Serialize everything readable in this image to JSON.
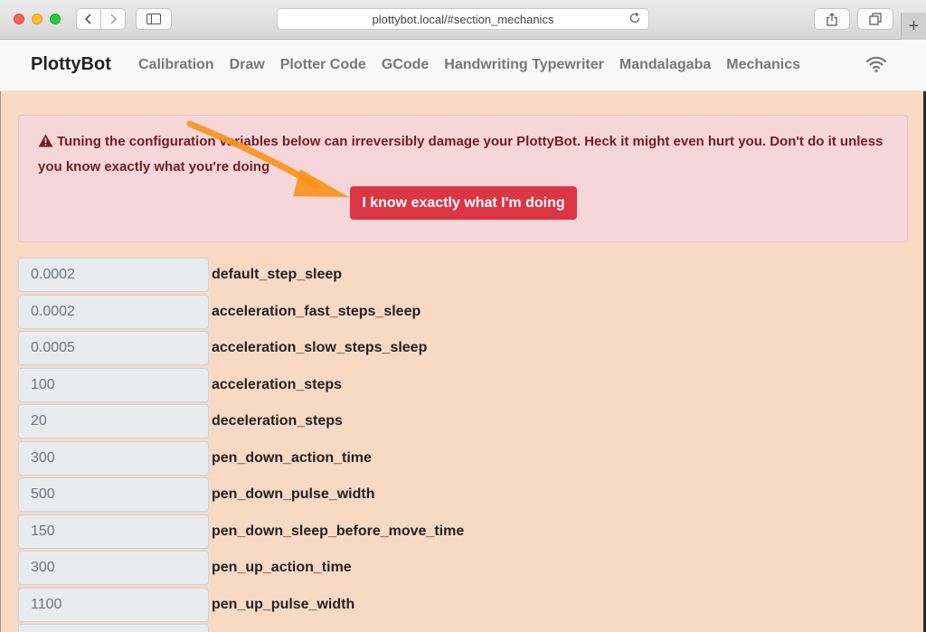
{
  "browser": {
    "url": "plottybot.local/#section_mechanics"
  },
  "nav": {
    "brand": "PlottyBot",
    "links": [
      "Calibration",
      "Draw",
      "Plotter Code",
      "GCode",
      "Handwriting Typewriter",
      "Mandalagaba",
      "Mechanics"
    ]
  },
  "alert": {
    "message": "Tuning the configuration variables below can irreversibly damage your PlottyBot. Heck it might even hurt you. Don't do it unless you know exactly what you're doing",
    "button_label": "I know exactly what I'm doing",
    "colors": {
      "background": "#f6d6d9",
      "text": "#721c24",
      "button": "#dc3545"
    }
  },
  "config": [
    {
      "value": "0.0002",
      "name": "default_step_sleep"
    },
    {
      "value": "0.0002",
      "name": "acceleration_fast_steps_sleep"
    },
    {
      "value": "0.0005",
      "name": "acceleration_slow_steps_sleep"
    },
    {
      "value": "100",
      "name": "acceleration_steps"
    },
    {
      "value": "20",
      "name": "deceleration_steps"
    },
    {
      "value": "300",
      "name": "pen_down_action_time"
    },
    {
      "value": "500",
      "name": "pen_down_pulse_width"
    },
    {
      "value": "150",
      "name": "pen_down_sleep_before_move_time"
    },
    {
      "value": "300",
      "name": "pen_up_action_time"
    },
    {
      "value": "1100",
      "name": "pen_up_pulse_width"
    }
  ],
  "page_background": "#f8d9c4",
  "annotation_arrow_color": "#f7941d"
}
